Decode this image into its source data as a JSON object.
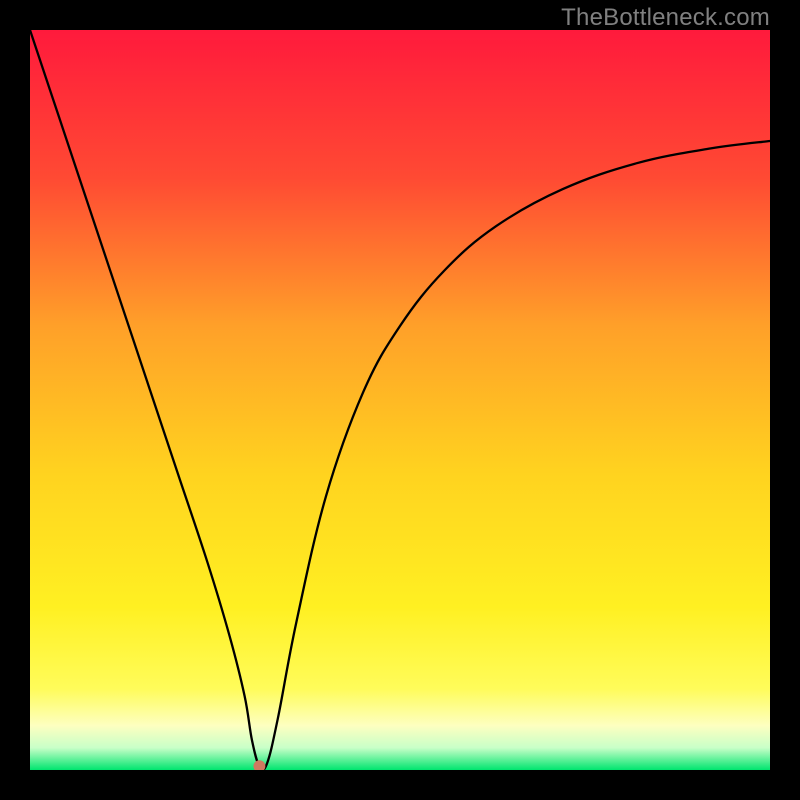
{
  "attribution": "TheBottleneck.com",
  "chart_data": {
    "type": "line",
    "title": "",
    "xlabel": "",
    "ylabel": "",
    "xlim": [
      0,
      100
    ],
    "ylim": [
      0,
      100
    ],
    "grid": false,
    "background_gradient": {
      "stops": [
        {
          "offset": 0.0,
          "color": "#ff1a3c"
        },
        {
          "offset": 0.2,
          "color": "#ff4a33"
        },
        {
          "offset": 0.4,
          "color": "#ffa029"
        },
        {
          "offset": 0.6,
          "color": "#ffd31f"
        },
        {
          "offset": 0.78,
          "color": "#fff022"
        },
        {
          "offset": 0.89,
          "color": "#fffc5a"
        },
        {
          "offset": 0.94,
          "color": "#fdffc0"
        },
        {
          "offset": 0.97,
          "color": "#c8ffc8"
        },
        {
          "offset": 1.0,
          "color": "#00e56f"
        }
      ]
    },
    "series": [
      {
        "name": "bottleneck-curve",
        "color": "#000000",
        "stroke_width": 2.3,
        "x": [
          0.0,
          4.0,
          8.0,
          12.0,
          16.0,
          20.0,
          24.0,
          27.0,
          29.0,
          30.0,
          31.0,
          32.0,
          33.5,
          36.0,
          40.0,
          45.0,
          50.0,
          56.0,
          63.0,
          72.0,
          82.0,
          92.0,
          100.0
        ],
        "values": [
          100.0,
          88.0,
          76.0,
          64.0,
          52.0,
          40.0,
          28.0,
          18.0,
          10.0,
          4.0,
          0.5,
          0.8,
          7.0,
          20.0,
          37.0,
          51.0,
          60.0,
          67.5,
          73.5,
          78.5,
          82.0,
          84.0,
          85.0
        ]
      }
    ],
    "marker": {
      "name": "optimal-point",
      "x": 31.0,
      "y": 0.5,
      "r": 6,
      "color": "#cf7a60"
    }
  }
}
